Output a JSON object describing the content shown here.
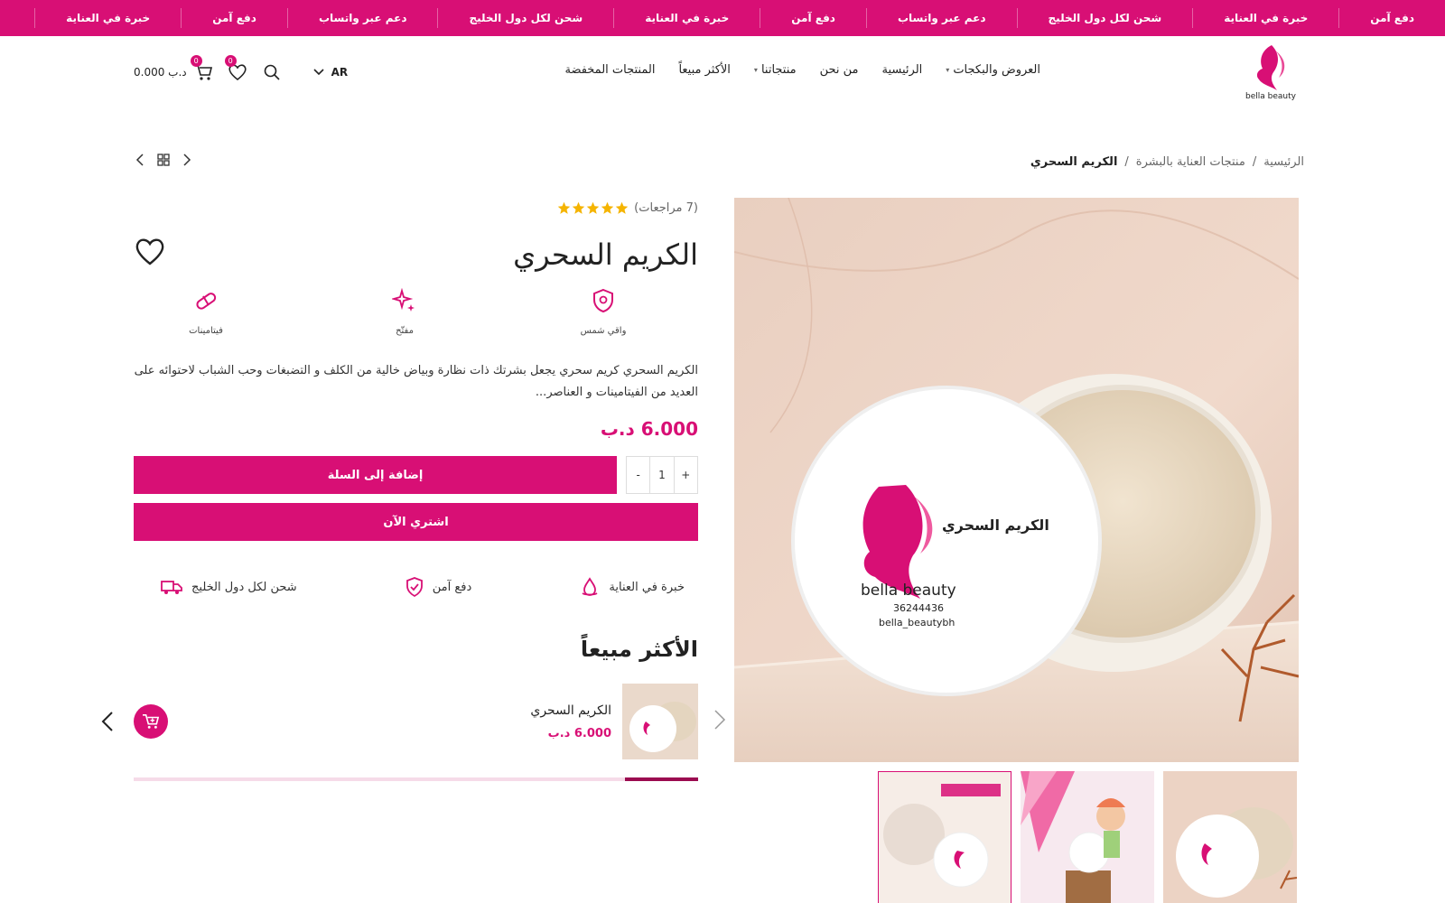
{
  "ticker": {
    "items": [
      "دفع آمن",
      "خبرة في العناية",
      "شحن لكل دول الخليج",
      "دعم عبر واتساب",
      "دفع آمن",
      "خبرة في العناية",
      "شحن لكل دول الخليج",
      "دعم عبر واتساب",
      "دفع آمن",
      "خبرة في العناية"
    ]
  },
  "header": {
    "logo_text": "bella beauty",
    "nav": [
      {
        "label": "العروض والبكجات",
        "has_dropdown": true
      },
      {
        "label": "الرئيسية",
        "has_dropdown": false
      },
      {
        "label": "من نحن",
        "has_dropdown": false
      },
      {
        "label": "منتجاتنا",
        "has_dropdown": true
      },
      {
        "label": "الأكثر مبيعاً",
        "has_dropdown": false
      },
      {
        "label": "المنتجات المخفضة",
        "has_dropdown": false
      }
    ],
    "lang": "AR",
    "wishlist_count": "0",
    "cart_count": "0",
    "cart_total": "0.000 د.ب"
  },
  "breadcrumb": {
    "home": "الرئيسية",
    "category": "منتجات العناية بالبشرة",
    "current": "الكريم السحري",
    "sep": "/"
  },
  "product": {
    "rating_value": 5,
    "reviews": "(7 مراجعات)",
    "title": "الكريم السحري",
    "features": [
      {
        "label": "فيتامينات",
        "icon": "pill-icon"
      },
      {
        "label": "مفتّح",
        "icon": "sparkle-icon"
      },
      {
        "label": "واقي شمس",
        "icon": "sun-shield-icon"
      }
    ],
    "description": "الكريم السحري كريم سحري يجعل بشرتك ذات نظارة وبياض خالية من الكلف و التضبغات وحب الشباب لاحتوائه على العديد من الفيتامينات و العناصر...",
    "price": "6.000 د.ب",
    "quantity": "1",
    "qty_plus": "+",
    "qty_minus": "-",
    "add_to_cart": "إضافة إلى السلة",
    "buy_now": "اشتري الآن",
    "perks": [
      {
        "label": "شحن لكل دول الخليج",
        "icon": "truck-icon"
      },
      {
        "label": "دفع آمن",
        "icon": "shield-check-icon"
      },
      {
        "label": "خبرة في العناية",
        "icon": "drop-icon"
      }
    ],
    "image_label_ar": "الكريم السحري",
    "image_brand": "bella beauty",
    "image_phone": "36244436",
    "image_handle": "bella_beautybh"
  },
  "best_sellers": {
    "title": "الأكثر مبيعاً",
    "items": [
      {
        "name": "الكريم السحري",
        "price": "6.000 د.ب"
      }
    ],
    "scroll_progress": 0.13
  },
  "colors": {
    "brand": "#d80f75",
    "brand_dark": "#9b0b50",
    "star": "#f5b400"
  }
}
